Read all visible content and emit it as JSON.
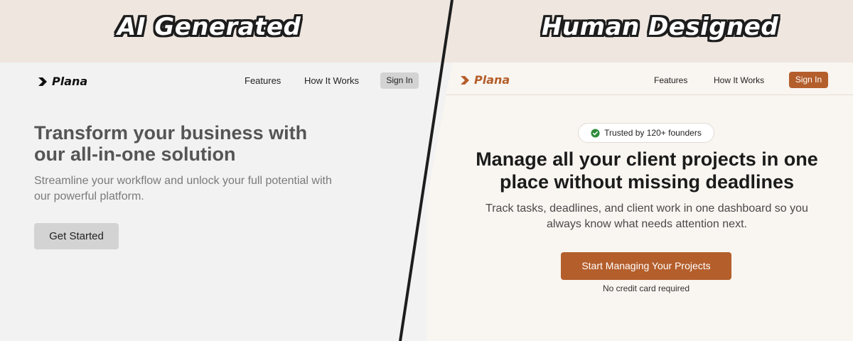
{
  "banner": {
    "left_title": "AI Generated",
    "right_title": "Human Designed",
    "background": "#efe6df"
  },
  "left": {
    "logo_text": "Plana",
    "nav": {
      "features": "Features",
      "how_it_works": "How It Works",
      "sign_in": "Sign In"
    },
    "headline": "Transform your business with our all-in-one solution",
    "subheadline": "Streamline your workflow and unlock your full potential with our powerful platform.",
    "cta": "Get Started",
    "colors": {
      "background": "#f2f2f2",
      "button": "#d3d3d3",
      "text": "#555555"
    }
  },
  "right": {
    "logo_text": "Plana",
    "nav": {
      "features": "Features",
      "how_it_works": "How It Works",
      "sign_in": "Sign In"
    },
    "badge": "Trusted by 120+ founders",
    "headline": "Manage all your client projects in one place without missing deadlines",
    "subheadline": "Track tasks, deadlines, and client work in one dashboard so you always know what needs attention next.",
    "cta": "Start Managing Your Projects",
    "note": "No credit card required",
    "icons": {
      "logo": "chevron-right-icon",
      "badge": "check-circle-icon"
    },
    "colors": {
      "background": "#f9f5f0",
      "accent": "#b45e2b",
      "badge_check": "#2e8b3a"
    }
  }
}
